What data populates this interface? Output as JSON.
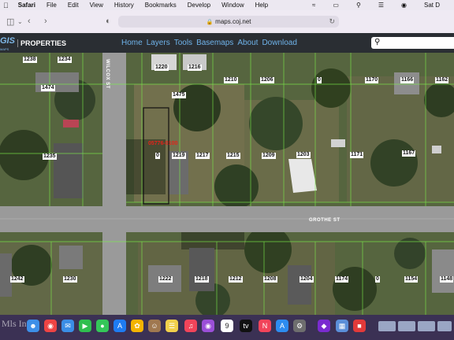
{
  "menubar": {
    "apple": "",
    "app": "Safari",
    "items": [
      "File",
      "Edit",
      "View",
      "History",
      "Bookmarks",
      "Develop",
      "Window",
      "Help"
    ],
    "clock": "Sat D",
    "status_icons": [
      "wifi-icon",
      "battery-icon",
      "search-icon",
      "control-center-icon",
      "siri-icon"
    ]
  },
  "browser": {
    "url": "maps.coj.net",
    "icons": [
      "sidebar-icon",
      "back-icon",
      "forward-icon",
      "privacy-icon",
      "lock-icon",
      "reload-icon"
    ]
  },
  "site": {
    "logo": "GIS",
    "logo_sub": "MAPS",
    "section": "PROPERTIES",
    "nav": [
      "Home",
      "Layers",
      "Tools",
      "Basemaps",
      "About",
      "Download"
    ],
    "search_placeholder": ""
  },
  "map": {
    "selected_parcel_label": "05776-0100",
    "streets": [
      "WILCOX ST",
      "GROTHE ST"
    ],
    "parcels": [
      "1238",
      "1234",
      "1220",
      "1216",
      "1474",
      "1210",
      "1206",
      "0",
      "1170",
      "1166",
      "1162",
      "1475",
      "0",
      "1219",
      "1217",
      "1215",
      "1209",
      "1203",
      "1171",
      "1167",
      "1235",
      "1242",
      "1230",
      "1222",
      "1218",
      "1212",
      "1208",
      "1204",
      "1174",
      "0",
      "1154",
      "1148"
    ]
  },
  "dock": {
    "watermark": "Mls Inc",
    "calendar_day": "9",
    "apps": [
      "finder",
      "launchpad",
      "chrome",
      "mail",
      "facetime",
      "messages",
      "appstore",
      "photos",
      "contacts",
      "notes",
      "music",
      "podcasts",
      "calendar",
      "tv",
      "news",
      "maps-alt",
      "settings",
      "vpn",
      "preview",
      "crm"
    ]
  },
  "colors": {
    "site_bar": "#2a2e33",
    "nav_link": "#6fb3ea",
    "parcel_line": "#7cf04a",
    "selected_parcel": "#111111",
    "road": "#9a9a9a"
  }
}
